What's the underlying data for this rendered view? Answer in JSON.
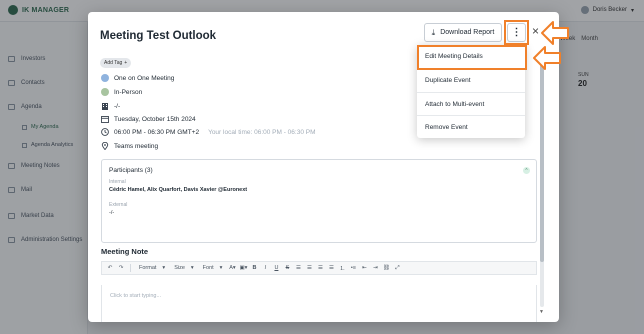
{
  "app": {
    "logo_text": "IK MANAGER",
    "user_name": "Doris Becker",
    "week_view_label": "Week",
    "month_view_label": "Month",
    "bg_day_label": "SUN",
    "bg_day_number": "20"
  },
  "sidebar": {
    "items": [
      {
        "label": "Investors",
        "icon": "investors-icon"
      },
      {
        "label": "Contacts",
        "icon": "contacts-icon"
      },
      {
        "label": "Agenda",
        "icon": "agenda-icon"
      },
      {
        "label": "Meeting Notes",
        "icon": "notes-icon"
      },
      {
        "label": "Mail",
        "icon": "mail-icon"
      },
      {
        "label": "Market Data",
        "icon": "market-icon"
      },
      {
        "label": "Administration Settings",
        "icon": "settings-icon"
      }
    ],
    "sub_items": [
      {
        "label": "My Agenda"
      },
      {
        "label": "Agenda Analytics"
      }
    ]
  },
  "modal": {
    "title": "Meeting Test Outlook",
    "download_label": "Download Report",
    "more_glyph": "⋮",
    "close_glyph": "×",
    "tag_label": "Add Tag",
    "tag_glyph": "+",
    "details": {
      "meeting_type": "One on One Meeting",
      "meeting_format": "In-Person",
      "location": "-/-",
      "date": "Tuesday, October 15th 2024",
      "time": "06:00 PM - 06:30 PM GMT+2",
      "local_time": "Your local time: 06:00 PM - 06:30 PM",
      "venue": "Teams meeting"
    },
    "participants": {
      "title": "Participants (3)",
      "internal_label": "Internal",
      "internal_value": "Cédric Hamel, Alix Quarfort, Davis Xavier @Euronext",
      "external_label": "External",
      "external_value": "-/-"
    },
    "note": {
      "title": "Meeting Note",
      "placeholder": "Click to start typing...",
      "toolbar": {
        "format_label": "Format",
        "size_label": "Size",
        "font_label": "Font"
      }
    }
  },
  "menu": {
    "items": [
      {
        "label": "Edit Meeting Details"
      },
      {
        "label": "Duplicate Event"
      },
      {
        "label": "Attach to Multi-event"
      },
      {
        "label": "Remove Event"
      }
    ]
  },
  "colors": {
    "highlight": "#f0802a",
    "brand": "#2d6a4f"
  }
}
